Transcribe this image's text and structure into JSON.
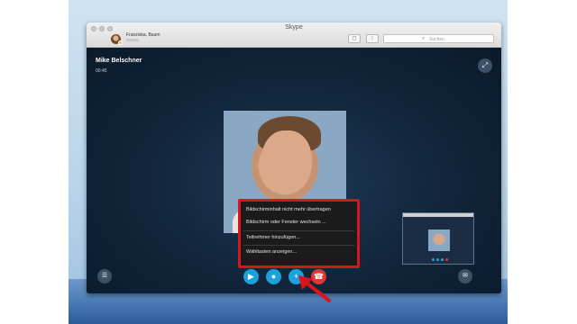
{
  "window": {
    "title": "Skype"
  },
  "profile": {
    "name": "Franziska, Baum"
  },
  "toolbar": {
    "search_placeholder": "Suchen"
  },
  "call": {
    "caller_name": "Mike Belschner",
    "duration": "00:45"
  },
  "share_menu": {
    "items": [
      "Bildschirminhalt nicht mehr übertragen",
      "Bildschirm oder Fenster wechseln ...",
      "Teilnehmer hinzufügen...",
      "Wähltasten anzeigen..."
    ]
  },
  "colors": {
    "highlight": "#d9141d",
    "call_button_blue": "#1da1dd",
    "hangup_red": "#e63333"
  }
}
